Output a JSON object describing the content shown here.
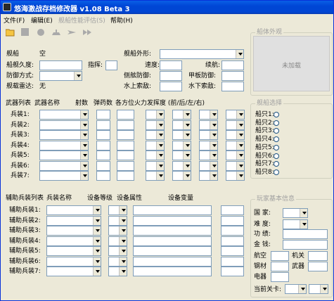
{
  "window": {
    "title": "悠海激战存档修改器 v1.08 Beta 3"
  },
  "menu": {
    "file": "文件(F)",
    "edit": "编辑(E)",
    "evaluate": "舰船性能评估(S)",
    "help": "帮助(H)"
  },
  "ship": {
    "name_label": "舰船",
    "name_value": "空",
    "shape_label": "舰船外形:",
    "durability_label": "船舰久度:",
    "command_label": "指挥:",
    "speed_label": "速度:",
    "range_label": "续航:",
    "defense_label": "防御方式:",
    "side_armor_label": "侧舷防御:",
    "deck_armor_label": "甲板防御:",
    "radar_label": "舰载雷达:",
    "radar_value": "无",
    "surface_search_label": "水上索敌:",
    "underwater_search_label": "水下索敌:"
  },
  "weapons": {
    "header": {
      "list": "武器列表",
      "name": "武器名称",
      "range": "射数",
      "ammo": "弹药数",
      "firepower": "各方位火力发挥度 (前/后/左/右)"
    },
    "rows": [
      "兵装1:",
      "兵装2:",
      "兵装3:",
      "兵装4:",
      "兵装5:",
      "兵装6:",
      "兵装7:"
    ]
  },
  "aux": {
    "header": {
      "list": "辅助兵装列表",
      "name": "兵装名称",
      "level": "设备等级",
      "attr": "设备属性",
      "value": "设备变量"
    },
    "rows": [
      "辅助兵装1:",
      "辅助兵装2:",
      "辅助兵装3:",
      "辅助兵装4:",
      "辅助兵装5:",
      "辅助兵装6:",
      "辅助兵装7:"
    ]
  },
  "appearance": {
    "title": "船体外观",
    "placeholder": "未加载"
  },
  "selection": {
    "title": "舰船选择",
    "ships": [
      "船只1:",
      "船只2:",
      "船只3:",
      "船只4:",
      "船只5:",
      "船只6:",
      "船只7:",
      "船只8:"
    ]
  },
  "player": {
    "title": "玩家基本信息",
    "country": "国  家:",
    "difficulty": "难  度:",
    "merit": "功  绩:",
    "money": "金  钱:",
    "air": "航空",
    "aircraft": "机关",
    "steel": "钢材",
    "weapon": "武器",
    "electric": "电器",
    "current_level": "当前关卡:"
  },
  "colors": {
    "titlebar": "#0046d5",
    "window_bg": "#ece9d8",
    "group_title": "#a0a0a0"
  }
}
